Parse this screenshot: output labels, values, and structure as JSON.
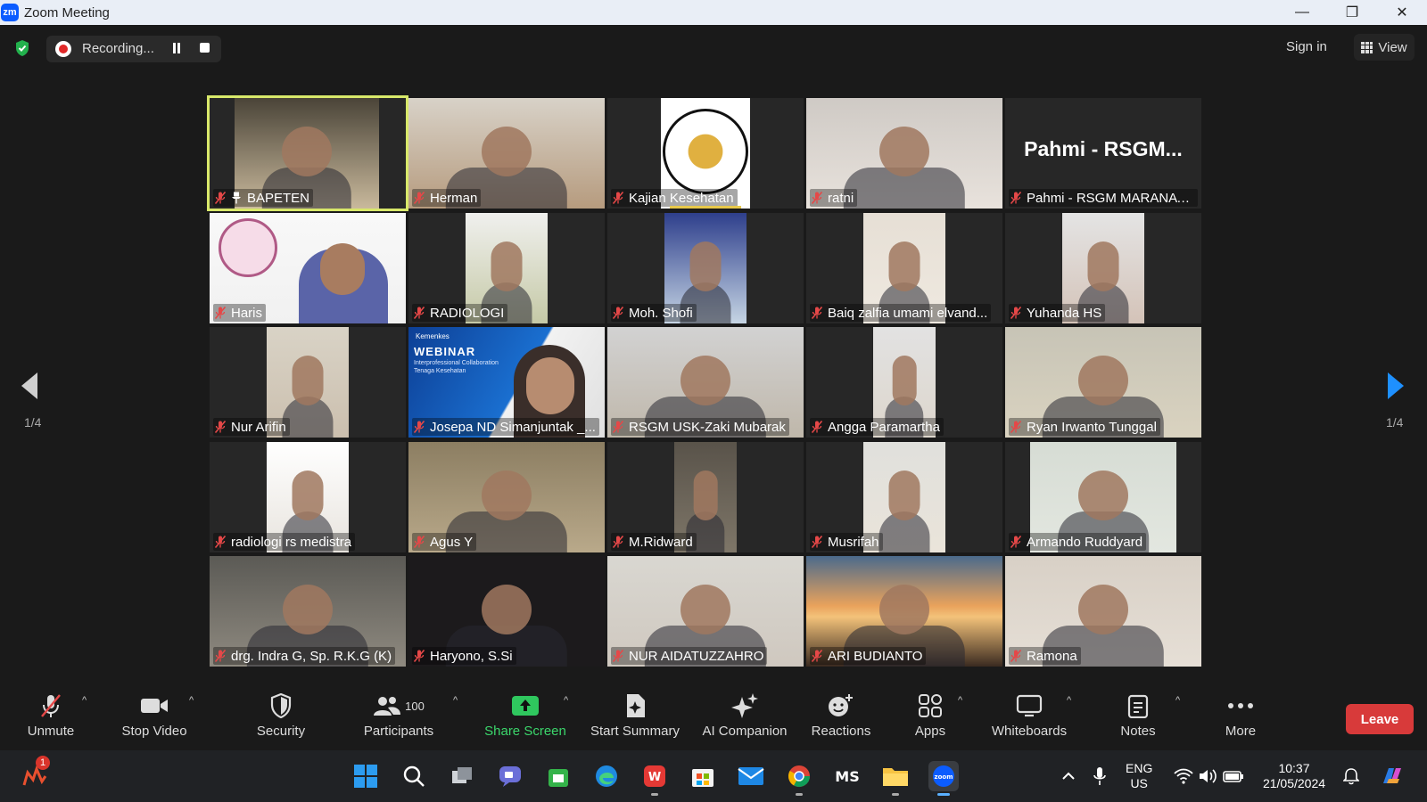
{
  "window": {
    "title": "Zoom Meeting",
    "logo_text": "zm"
  },
  "topbar": {
    "recording_label": "Recording...",
    "sign_in": "Sign in",
    "view_label": "View"
  },
  "tiles": [
    {
      "name": "BAPETEN",
      "pinned": true,
      "active": true
    },
    {
      "name": "Herman"
    },
    {
      "name": "Kajian Kesehatan"
    },
    {
      "name": "ratni"
    },
    {
      "name": "Pahmi - RSGM MARANAT...",
      "display_text": "Pahmi  -  RSGM..."
    },
    {
      "name": "Haris"
    },
    {
      "name": "RADIOLOGI"
    },
    {
      "name": "Moh. Shofi"
    },
    {
      "name": "Baiq zalfia umami elvand..."
    },
    {
      "name": "Yuhanda HS"
    },
    {
      "name": "Nur Arifin"
    },
    {
      "name": "Josepa ND Simanjuntak _...",
      "webinar": {
        "brand": "Kemenkes",
        "title": "WEBINAR",
        "subtitle_1": "Interprofessional Collaboration",
        "subtitle_2": "Tenaga Kesehatan"
      }
    },
    {
      "name": "RSGM USK-Zaki Mubarak"
    },
    {
      "name": "Angga Paramartha"
    },
    {
      "name": "Ryan Irwanto Tunggal"
    },
    {
      "name": "radiologi rs medistra"
    },
    {
      "name": "Agus Y"
    },
    {
      "name": "M.Ridward"
    },
    {
      "name": "Musrifah"
    },
    {
      "name": "Armando Ruddyard"
    },
    {
      "name": "drg. Indra G, Sp. R.K.G (K)"
    },
    {
      "name": "Haryono, S.Si"
    },
    {
      "name": "NUR AIDATUZZAHRO"
    },
    {
      "name": "ARI BUDIANTO"
    },
    {
      "name": "Ramona"
    }
  ],
  "pagination": {
    "left": "1/4",
    "right": "1/4"
  },
  "toolbar": {
    "unmute": "Unmute",
    "stop_video": "Stop Video",
    "security": "Security",
    "participants": "Participants",
    "participants_count": "100",
    "share_screen": "Share Screen",
    "start_summary": "Start Summary",
    "ai_companion": "AI Companion",
    "reactions": "Reactions",
    "apps": "Apps",
    "whiteboards": "Whiteboards",
    "notes": "Notes",
    "more": "More",
    "leave": "Leave"
  },
  "taskbar": {
    "notification_badge": "1",
    "lang_1": "ENG",
    "lang_2": "US",
    "time": "10:37",
    "date": "21/05/2024"
  },
  "colors": {
    "accent_green": "#3bd66b",
    "leave_red": "#d83a3a",
    "active_speaker": "#d8e86a",
    "nav_blue": "#1e90ff"
  }
}
